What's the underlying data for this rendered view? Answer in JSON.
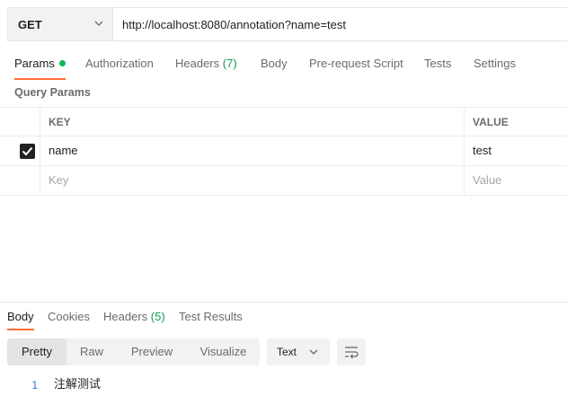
{
  "request": {
    "method": "GET",
    "url": "http://localhost:8080/annotation?name=test"
  },
  "request_tabs": {
    "params": "Params",
    "authorization": "Authorization",
    "headers": "Headers",
    "headers_count": "(7)",
    "body": "Body",
    "pre_request_script": "Pre-request Script",
    "tests": "Tests",
    "settings": "Settings"
  },
  "query_params": {
    "title": "Query Params",
    "columns": {
      "key": "KEY",
      "value": "VALUE"
    },
    "rows": [
      {
        "checked": true,
        "key": "name",
        "value": "test"
      }
    ],
    "key_placeholder": "Key",
    "value_placeholder": "Value"
  },
  "response_tabs": {
    "body": "Body",
    "cookies": "Cookies",
    "headers": "Headers",
    "headers_count": "(5)",
    "test_results": "Test Results"
  },
  "view_modes": {
    "pretty": "Pretty",
    "raw": "Raw",
    "preview": "Preview",
    "visualize": "Visualize",
    "selected": "Pretty"
  },
  "format_select": {
    "value": "Text"
  },
  "response_body": {
    "lines": [
      {
        "number": "1",
        "text": "注解测试"
      }
    ]
  },
  "colors": {
    "accent": "#ff6c37",
    "params_dot": "#0cbb52",
    "count_green": "#0f9d58",
    "line_number": "#3a7bd5"
  },
  "icons": {
    "method_dropdown": "chevron-down-icon",
    "checkbox": "check-icon",
    "format_dropdown": "chevron-down-icon",
    "wrap": "wrap-lines-icon"
  }
}
